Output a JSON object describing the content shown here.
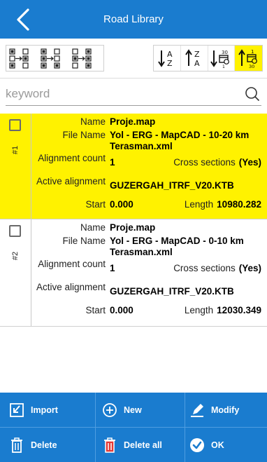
{
  "header": {
    "title": "Road Library"
  },
  "search": {
    "placeholder": "keyword"
  },
  "list": {
    "labels": {
      "name": "Name",
      "file_name": "File Name",
      "alignment_count": "Alignment count",
      "cross_sections": "Cross sections",
      "active_alignment": "Active alignment",
      "start": "Start",
      "length": "Length"
    },
    "items": [
      {
        "index": "#1",
        "selected": true,
        "name": "Proje.map",
        "file_name": "Yol - ERG - MapCAD - 10-20 km Terasman.xml",
        "alignment_count": "1",
        "cross_sections": "(Yes)",
        "active_alignment": "GUZERGAH_ITRF_V20.KTB",
        "start": "0.000",
        "length": "10980.282"
      },
      {
        "index": "#2",
        "selected": false,
        "name": "Proje.map",
        "file_name": "Yol - ERG - MapCAD - 0-10 km Terasman.xml",
        "alignment_count": "1",
        "cross_sections": "(Yes)",
        "active_alignment": "GUZERGAH_ITRF_V20.KTB",
        "start": "0.000",
        "length": "12030.349"
      }
    ]
  },
  "toolbar": {
    "sort_buttons": [
      {
        "icon": "sort-az-icon"
      },
      {
        "icon": "sort-za-icon"
      },
      {
        "icon": "sort-date-desc-icon"
      },
      {
        "icon": "sort-date-asc-icon",
        "active": true
      }
    ]
  },
  "bottom": {
    "import_label": "Import",
    "new_label": "New",
    "modify_label": "Modify",
    "delete_label": "Delete",
    "delete_all_label": "Delete all",
    "ok_label": "OK"
  },
  "colors": {
    "primary": "#1a7ccf",
    "highlight": "#fff200"
  }
}
